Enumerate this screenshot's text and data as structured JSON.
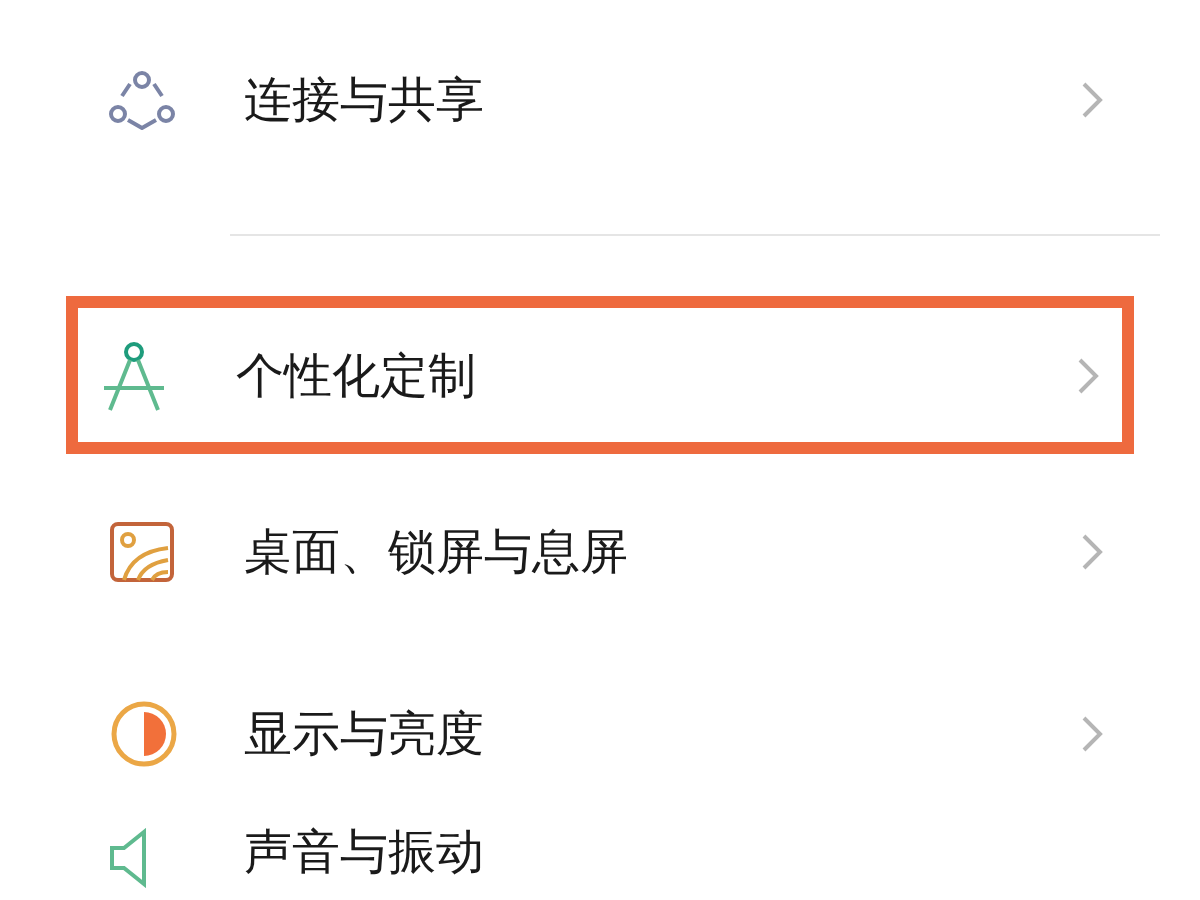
{
  "settings": [
    {
      "label": "连接与共享",
      "highlighted": false
    },
    {
      "label": "个性化定制",
      "highlighted": true
    },
    {
      "label": "桌面、锁屏与息屏",
      "highlighted": false
    },
    {
      "label": "显示与亮度",
      "highlighted": false
    },
    {
      "label": "声音与振动",
      "highlighted": false
    }
  ]
}
